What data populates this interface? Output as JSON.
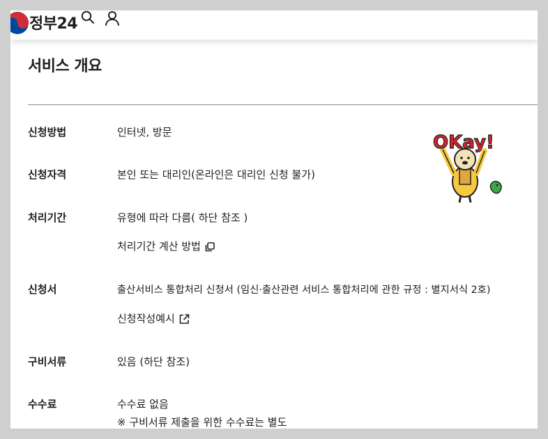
{
  "header": {
    "brand": "정부24",
    "icons": [
      "taegeuk-logo-icon",
      "search-icon",
      "user-icon"
    ]
  },
  "main": {
    "title": "서비스 개요",
    "rows": [
      {
        "label": "신청방법",
        "values": [
          "인터넷, 방문"
        ]
      },
      {
        "label": "신청자격",
        "values": [
          "본인 또는 대리인(온라인은 대리인 신청 불가)"
        ]
      },
      {
        "label": "처리기간",
        "values": [
          "유형에 따라 다름( 하단 참조 )",
          "처리기간 계산 방법"
        ]
      },
      {
        "label": "신청서",
        "values": [
          "출산서비스 통합처리 신청서 (임신·출산관련 서비스 통합처리에 관한 규정 : 별지서식 2호)",
          "신청작성예시"
        ]
      },
      {
        "label": "구비서류",
        "values": [
          "있음 (하단 참조)"
        ]
      },
      {
        "label": "수수료",
        "values": [
          "수수료 없음",
          "※ 구비서류 제출을 위한 수수료는 별도"
        ]
      }
    ]
  },
  "sticker": {
    "text": "OKay!"
  },
  "colors": {
    "background": "#cfcfcf",
    "logo_red": "#cd2e3a",
    "logo_blue": "#0047a0",
    "sticker_red": "#d8232a",
    "sticker_yellow": "#f7c93e"
  }
}
